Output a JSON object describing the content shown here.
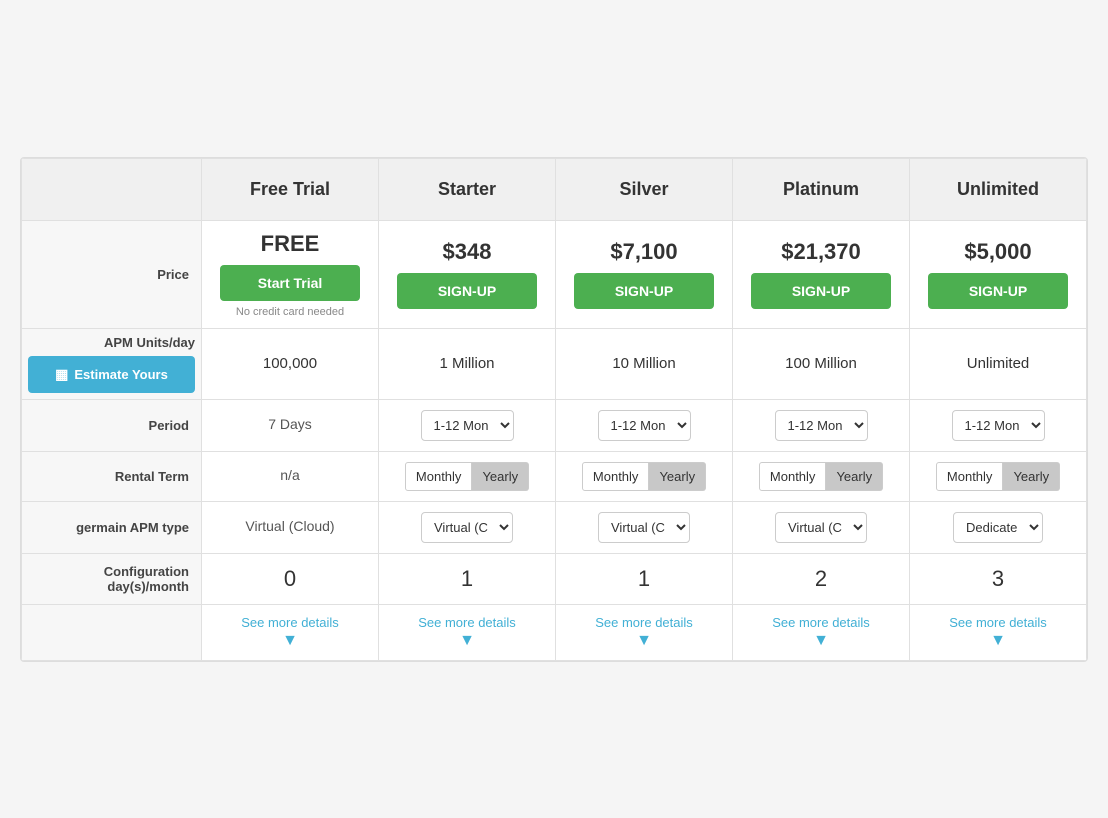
{
  "table": {
    "headers": [
      "",
      "Free Trial",
      "Starter",
      "Silver",
      "Platinum",
      "Unlimited"
    ],
    "rows": {
      "price": {
        "label": "Price",
        "values": [
          {
            "amount": "FREE",
            "btn_label": "Start Trial",
            "sub": "No credit card needed"
          },
          {
            "amount": "$348",
            "btn_label": "SIGN-UP"
          },
          {
            "amount": "$7,100",
            "btn_label": "SIGN-UP"
          },
          {
            "amount": "$21,370",
            "btn_label": "SIGN-UP"
          },
          {
            "amount": "$5,000",
            "btn_label": "SIGN-UP"
          }
        ]
      },
      "apm_units": {
        "label": "APM Units/day",
        "estimate_btn_label": "Estimate Yours",
        "values": [
          "100,000",
          "1 Million",
          "10 Million",
          "100 Million",
          "Unlimited"
        ]
      },
      "period": {
        "label": "Period",
        "values": [
          {
            "type": "text",
            "value": "7 Days"
          },
          {
            "type": "select",
            "options": [
              "1-12 Mon"
            ],
            "selected": "1-12 Mon"
          },
          {
            "type": "select",
            "options": [
              "1-12 Mon"
            ],
            "selected": "1-12 Mon"
          },
          {
            "type": "select",
            "options": [
              "1-12 Mon"
            ],
            "selected": "1-12 Mon"
          },
          {
            "type": "select",
            "options": [
              "1-12 Mon"
            ],
            "selected": "1-12 Mon"
          }
        ]
      },
      "rental_term": {
        "label": "Rental Term",
        "values": [
          {
            "type": "text",
            "value": "n/a"
          },
          {
            "type": "buttons",
            "monthly": "Monthly",
            "yearly": "Yearly",
            "active": "yearly"
          },
          {
            "type": "buttons",
            "monthly": "Monthly",
            "yearly": "Yearly",
            "active": "yearly"
          },
          {
            "type": "buttons",
            "monthly": "Monthly",
            "yearly": "Yearly",
            "active": "yearly"
          },
          {
            "type": "buttons",
            "monthly": "Monthly",
            "yearly": "Yearly",
            "active": "yearly"
          }
        ]
      },
      "apm_type": {
        "label": "germain APM type",
        "values": [
          {
            "type": "text",
            "value": "Virtual (Cloud)"
          },
          {
            "type": "select",
            "options": [
              "Virtual (C"
            ],
            "selected": "Virtual (C"
          },
          {
            "type": "select",
            "options": [
              "Virtual (C"
            ],
            "selected": "Virtual (C"
          },
          {
            "type": "select",
            "options": [
              "Virtual (C"
            ],
            "selected": "Virtual (C"
          },
          {
            "type": "select",
            "options": [
              "Dedicate"
            ],
            "selected": "Dedicate"
          }
        ]
      },
      "config_days": {
        "label": "Configuration day(s)/month",
        "values": [
          "0",
          "1",
          "1",
          "2",
          "3"
        ]
      },
      "see_more": {
        "label": "",
        "link_text": "See more details",
        "arrow": "▼"
      }
    },
    "colors": {
      "green": "#4caf50",
      "blue_light": "#42b0d5",
      "header_bg": "#f0f0f0",
      "row_label_bg": "#f7f7f7",
      "border": "#e0e0e0"
    }
  }
}
